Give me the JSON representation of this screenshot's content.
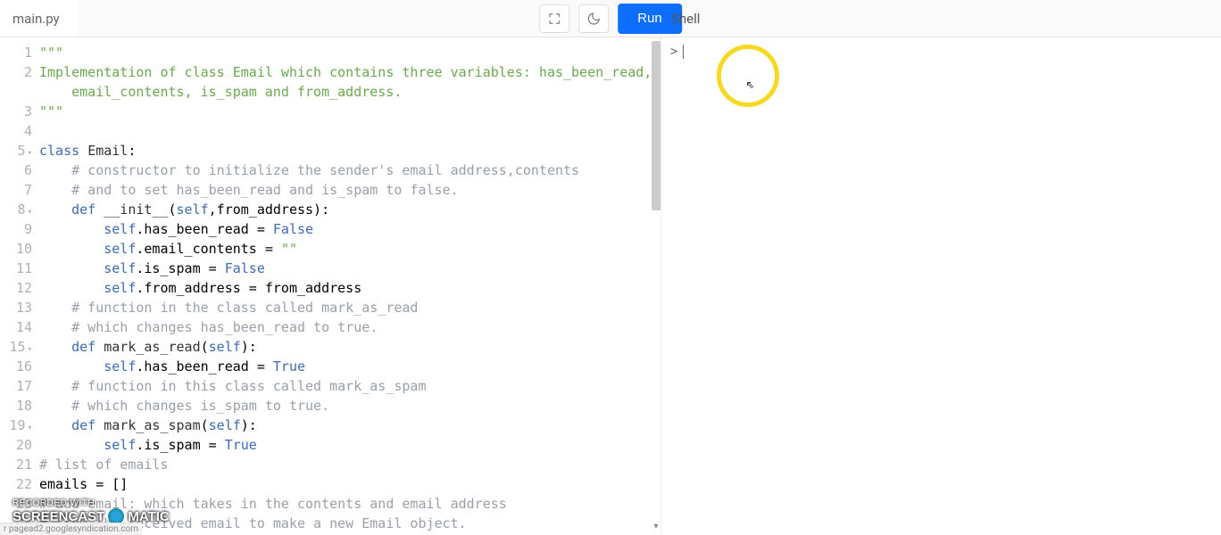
{
  "header": {
    "filename": "main.py",
    "run_label": "Run",
    "shell_label": "Shell"
  },
  "editor": {
    "lines": [
      {
        "n": "1",
        "fold": false,
        "html": "<span class='tok-str'>\"\"\"</span>"
      },
      {
        "n": "2",
        "fold": false,
        "html": "<span class='tok-str'>Implementation of class Email which contains three variables: has_been_read,</span>"
      },
      {
        "n": "",
        "fold": false,
        "html": "<span class='tok-str'>    email_contents, is_spam and from_address.</span>"
      },
      {
        "n": "3",
        "fold": false,
        "html": "<span class='tok-str'>\"\"\"</span>"
      },
      {
        "n": "4",
        "fold": false,
        "html": ""
      },
      {
        "n": "5",
        "fold": true,
        "html": "<span class='tok-kw'>class</span> <span class='tok-cls'>Email</span>:"
      },
      {
        "n": "6",
        "fold": false,
        "html": "    <span class='tok-cmt'># constructor to initialize the sender's email address,contents</span>"
      },
      {
        "n": "7",
        "fold": false,
        "html": "    <span class='tok-cmt'># and to set has_been_read and is_spam to false.</span>"
      },
      {
        "n": "8",
        "fold": true,
        "html": "    <span class='tok-def'>def</span> <span class='tok-fn'>__init__</span>(<span class='tok-self'>self</span>,from_address):"
      },
      {
        "n": "9",
        "fold": false,
        "html": "        <span class='tok-self'>self</span>.has_been_read = <span class='tok-bool'>False</span>"
      },
      {
        "n": "10",
        "fold": false,
        "html": "        <span class='tok-self'>self</span>.email_contents = <span class='tok-str'>\"\"</span>"
      },
      {
        "n": "11",
        "fold": false,
        "html": "        <span class='tok-self'>self</span>.is_spam = <span class='tok-bool'>False</span>"
      },
      {
        "n": "12",
        "fold": false,
        "html": "        <span class='tok-self'>self</span>.from_address = from_address"
      },
      {
        "n": "13",
        "fold": false,
        "html": "    <span class='tok-cmt'># function in the class called mark_as_read</span>"
      },
      {
        "n": "14",
        "fold": false,
        "html": "    <span class='tok-cmt'># which changes has_been_read to true.</span>"
      },
      {
        "n": "15",
        "fold": true,
        "html": "    <span class='tok-def'>def</span> <span class='tok-fn'>mark_as_read</span>(<span class='tok-self'>self</span>):"
      },
      {
        "n": "16",
        "fold": false,
        "html": "        <span class='tok-self'>self</span>.has_been_read = <span class='tok-bool'>True</span>"
      },
      {
        "n": "17",
        "fold": false,
        "html": "    <span class='tok-cmt'># function in this class called mark_as_spam</span>"
      },
      {
        "n": "18",
        "fold": false,
        "html": "    <span class='tok-cmt'># which changes is_spam to true.</span>"
      },
      {
        "n": "19",
        "fold": true,
        "html": "    <span class='tok-def'>def</span> <span class='tok-fn'>mark_as_spam</span>(<span class='tok-self'>self</span>):"
      },
      {
        "n": "20",
        "fold": false,
        "html": "        <span class='tok-self'>self</span>.is_spam = <span class='tok-bool'>True</span>"
      },
      {
        "n": "21",
        "fold": false,
        "html": "<span class='tok-cmt'># list of emails</span>"
      },
      {
        "n": "22",
        "fold": false,
        "html": "emails = []"
      },
      {
        "n": "23",
        "fold": false,
        "html": "<span class='tok-cmt'># add_email: which takes in the contents and email address</span>"
      },
      {
        "n": "24",
        "fold": false,
        "html": "<span class='tok-cmt'># from the received email to make a new Email object.</span>"
      }
    ]
  },
  "shell": {
    "prompt": ">"
  },
  "watermark": {
    "line1": "RECORDED WITH",
    "line2a": "SCREENCAST",
    "line2b": "MATIC"
  },
  "statusbar": {
    "text": "r pagead2.googlesyndication.com"
  }
}
